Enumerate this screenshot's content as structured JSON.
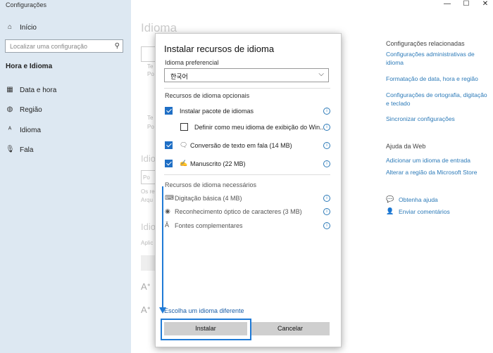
{
  "window": {
    "title": "Configurações",
    "minimize_icon": "—",
    "maximize_icon": "☐",
    "close_icon": "✕"
  },
  "sidebar": {
    "home": {
      "icon": "home-icon",
      "label": "Início"
    },
    "search_placeholder": "Localizar uma configuração",
    "section_title": "Hora e Idioma",
    "items": [
      {
        "icon": "calendar-icon",
        "label": "Data e hora"
      },
      {
        "icon": "globe-icon",
        "label": "Região"
      },
      {
        "icon": "language-icon",
        "label": "Idioma"
      },
      {
        "icon": "microphone-icon",
        "label": "Fala"
      }
    ]
  },
  "background_page": {
    "heading": "Idioma",
    "fragments": [
      "Te",
      "Po",
      "Te",
      "Po",
      "Idio",
      "Po",
      "Os re",
      "Arqu",
      "Idio",
      "Aplic"
    ]
  },
  "related": {
    "heading": "Configurações relacionadas",
    "links": [
      "Configurações administrativas de idioma",
      "Formatação de data, hora e região",
      "Configurações de ortografia, digitação e teclado",
      "Sincronizar configurações"
    ],
    "help_heading": "Ajuda da Web",
    "help_links": [
      "Adicionar um idioma de entrada",
      "Alterar a região da Microsoft Store"
    ],
    "get_help": "Obtenha ajuda",
    "feedback": "Enviar comentários"
  },
  "dialog": {
    "title": "Instalar recursos de idioma",
    "preferred_label": "Idioma preferencial",
    "selected_language": "한국어",
    "optional_heading": "Recursos de idioma opcionais",
    "optional": [
      {
        "label": "Instalar pacote de idiomas",
        "checked": true
      },
      {
        "label": "Definir como meu idioma de exibição do Win...",
        "checked": false
      },
      {
        "label": "Conversão de texto em fala (14 MB)",
        "checked": true
      },
      {
        "label": "Manuscrito (22 MB)",
        "checked": true
      }
    ],
    "required_heading": "Recursos de idioma necessários",
    "required": [
      "Digitação básica (4 MB)",
      "Reconhecimento óptico de caracteres (3 MB)",
      "Fontes complementares"
    ],
    "choose_link": "Escolha um idioma diferente",
    "install_label": "Instalar",
    "cancel_label": "Cancelar"
  },
  "colors": {
    "accent": "#1f6fc5",
    "sidebar_bg": "#dde8f2",
    "link": "#2c7ab8"
  }
}
